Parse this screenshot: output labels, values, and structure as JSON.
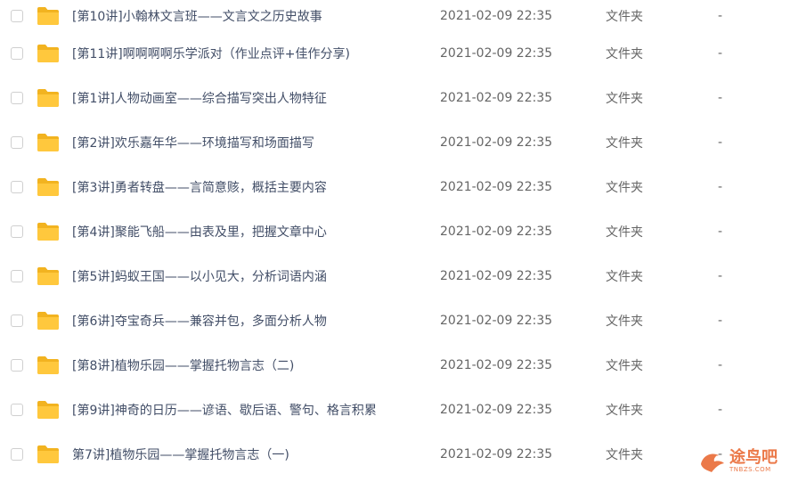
{
  "files": [
    {
      "name": "[第10讲]小翰林文言班——文言文之历史故事",
      "date": "2021-02-09 22:35",
      "type": "文件夹",
      "size": "-"
    },
    {
      "name": "[第11讲]啊啊啊啊乐学派对（作业点评+佳作分享)",
      "date": "2021-02-09 22:35",
      "type": "文件夹",
      "size": "-"
    },
    {
      "name": "[第1讲]人物动画室——综合描写突出人物特征",
      "date": "2021-02-09 22:35",
      "type": "文件夹",
      "size": "-"
    },
    {
      "name": "[第2讲]欢乐嘉年华——环境描写和场面描写",
      "date": "2021-02-09 22:35",
      "type": "文件夹",
      "size": "-"
    },
    {
      "name": "[第3讲]勇者转盘——言简意赅，概括主要内容",
      "date": "2021-02-09 22:35",
      "type": "文件夹",
      "size": "-"
    },
    {
      "name": "[第4讲]聚能飞船——由表及里，把握文章中心",
      "date": "2021-02-09 22:35",
      "type": "文件夹",
      "size": "-"
    },
    {
      "name": "[第5讲]蚂蚁王国——以小见大，分析词语内涵",
      "date": "2021-02-09 22:35",
      "type": "文件夹",
      "size": "-"
    },
    {
      "name": "[第6讲]夺宝奇兵——兼容并包，多面分析人物",
      "date": "2021-02-09 22:35",
      "type": "文件夹",
      "size": "-"
    },
    {
      "name": "[第8讲]植物乐园——掌握托物言志（二)",
      "date": "2021-02-09 22:35",
      "type": "文件夹",
      "size": "-"
    },
    {
      "name": "[第9讲]神奇的日历——谚语、歇后语、警句、格言积累",
      "date": "2021-02-09 22:35",
      "type": "文件夹",
      "size": "-"
    },
    {
      "name": "第7讲]植物乐园——掌握托物言志（一)",
      "date": "2021-02-09 22:35",
      "type": "文件夹",
      "size": "-"
    }
  ],
  "watermark": {
    "title": "途鸟吧",
    "url": "TNBZS.COM"
  },
  "colors": {
    "folder": "#ffc83d",
    "folder_dark": "#f2b320",
    "name": "#424e67",
    "meta": "#666666"
  }
}
